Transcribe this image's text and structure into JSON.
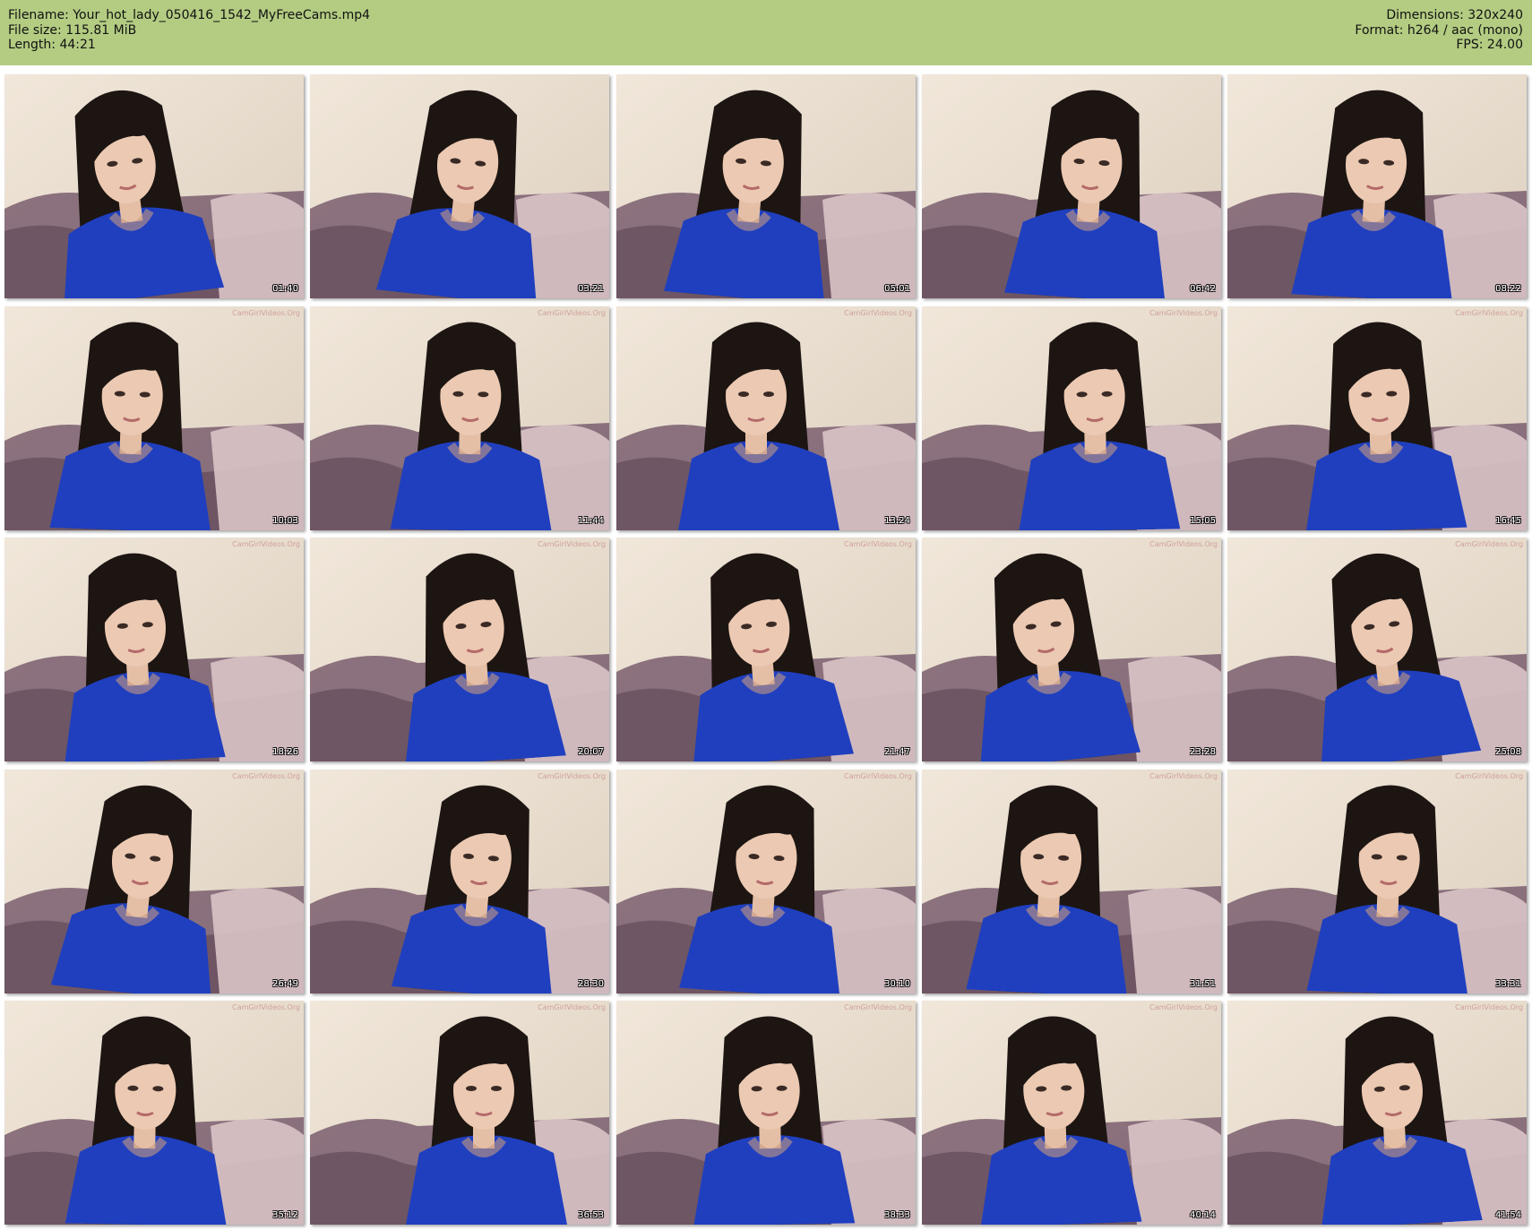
{
  "header": {
    "filename_label": "Filename:",
    "filename": "Your_hot_lady_050416_1542_MyFreeCams.mp4",
    "filesize_label": "File size:",
    "filesize": "115.81 MiB",
    "length_label": "Length:",
    "length": "44:21",
    "dimensions_label": "Dimensions:",
    "dimensions": "320x240",
    "format_label": "Format:",
    "format": "h264 / aac (mono)",
    "fps_label": "FPS:",
    "fps": "24.00"
  },
  "colors": {
    "header_bg": "#b3cc82",
    "shirt": "#1f3fbf",
    "hair": "#1c1512",
    "wall": "#e9dccb",
    "couch": "#7a5e6e"
  },
  "watermark": "CamGirlVideos.Org",
  "thumbnails": [
    {
      "time": "01:40"
    },
    {
      "time": "03:21"
    },
    {
      "time": "05:01"
    },
    {
      "time": "06:42"
    },
    {
      "time": "08:22"
    },
    {
      "time": "10:03"
    },
    {
      "time": "11:44"
    },
    {
      "time": "13:24"
    },
    {
      "time": "15:05"
    },
    {
      "time": "16:45"
    },
    {
      "time": "18:26"
    },
    {
      "time": "20:07"
    },
    {
      "time": "21:47"
    },
    {
      "time": "23:28"
    },
    {
      "time": "25:08"
    },
    {
      "time": "26:49"
    },
    {
      "time": "28:30"
    },
    {
      "time": "30:10"
    },
    {
      "time": "31:51"
    },
    {
      "time": "33:31"
    },
    {
      "time": "35:12"
    },
    {
      "time": "36:53"
    },
    {
      "time": "38:33"
    },
    {
      "time": "40:14"
    },
    {
      "time": "41:54"
    }
  ]
}
